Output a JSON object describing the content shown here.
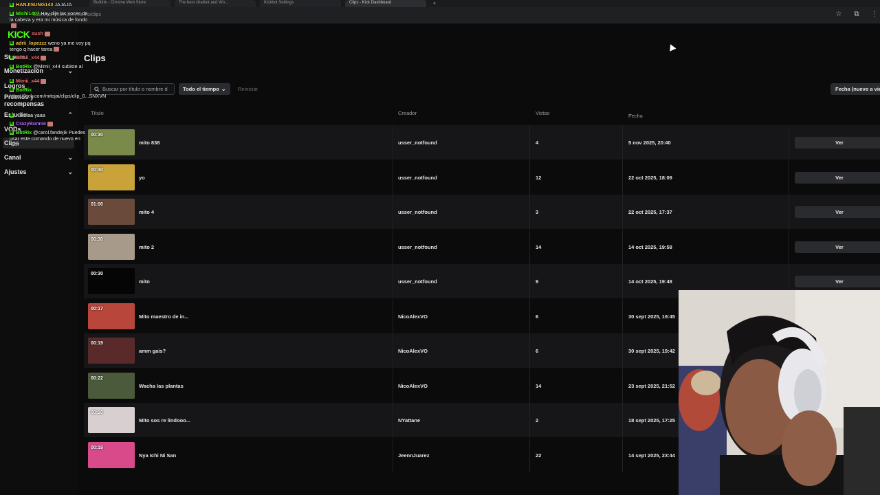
{
  "browser": {
    "tabs": [
      "Builtink - Chrome Web Store",
      "The best chatbot and Wo...",
      "Kickbot Settings",
      "Clips - Kick Dashboard"
    ],
    "url": "dashboard.kick.com/studio/clips"
  },
  "chat": {
    "logo": "KICK",
    "messages": [
      {
        "user": "HANJISUNG143",
        "user_color": "#f6c343",
        "text": "JAJAJA"
      },
      {
        "user": "Michi1407",
        "user_color": "#53fc18",
        "text": "Hay dije las voces de la cabeza y era mi música de fondo"
      },
      {
        "user": "sush",
        "user_color": "#f26d6d",
        "text": ""
      },
      {
        "user": "adrii_lopezzz",
        "user_color": "#f6c343",
        "text": "weno ya me voy pq tengo q hacer tarea"
      },
      {
        "user": "Mimii_x44",
        "user_color": "#f26d6d",
        "text": ""
      },
      {
        "user": "BotRix",
        "user_color": "#53fc18",
        "text": "@Mimii_x44 subiste al"
      },
      {
        "user": "Mimii_x44",
        "user_color": "#f26d6d",
        "text": ""
      },
      {
        "user": "BotRix",
        "user_color": "#53fc18",
        "text": "https://kick.com/mitojai/clips/clip_0...SNXVN"
      },
      {
        "user": "Kikelaa",
        "user_color": "#cfcfcf",
        "text": "yaaa"
      },
      {
        "user": "CrazyBunnie",
        "user_color": "#b86bff",
        "text": ""
      },
      {
        "user": "BotRix",
        "user_color": "#53fc18",
        "text": "@carol.fandejik Puedes usar este comando de nuevo en 49s."
      }
    ]
  },
  "sidebar": {
    "items": [
      {
        "label": "Stream",
        "has_chevron": false
      },
      {
        "label": "Monetización",
        "has_chevron": true
      },
      {
        "label": "Logros",
        "has_chevron": false
      },
      {
        "label": "Premios y recompensas",
        "has_chevron": false
      },
      {
        "label": "Estudio",
        "has_chevron": true
      },
      {
        "label": "VODs",
        "has_chevron": false
      },
      {
        "label": "Clips",
        "has_chevron": false
      },
      {
        "label": "Canal",
        "has_chevron": true
      },
      {
        "label": "Ajustes",
        "has_chevron": true
      }
    ]
  },
  "main": {
    "title": "Clips",
    "search_placeholder": "Buscar por título o nombre d",
    "time_filter": "Todo el tiempo",
    "reset_label": "Reiniciar",
    "sort_label": "Fecha (nuevo a viejo)",
    "columns": {
      "title": "Título",
      "creator": "Creador",
      "views": "Vistas",
      "date": "Fecha"
    },
    "rows": [
      {
        "duration": "00:30",
        "title": "mito 838",
        "creator": "usser_notfound",
        "views": "4",
        "date": "5 nov 2025, 20:40",
        "action": "Ver",
        "thumb_color": "#7a8a4a"
      },
      {
        "duration": "00:30",
        "title": "yo",
        "creator": "usser_notfound",
        "views": "12",
        "date": "22 oct 2025, 18:09",
        "action": "Ver",
        "thumb_color": "#c9a23a"
      },
      {
        "duration": "01:00",
        "title": "mito 4",
        "creator": "usser_notfound",
        "views": "3",
        "date": "22 oct 2025, 17:37",
        "action": "Ver",
        "thumb_color": "#6a4a3a"
      },
      {
        "duration": "00:30",
        "title": "mito 2",
        "creator": "usser_notfound",
        "views": "14",
        "date": "14 oct 2025, 19:58",
        "action": "Ver",
        "thumb_color": "#a89a8a"
      },
      {
        "duration": "00:30",
        "title": "mito",
        "creator": "usser_notfound",
        "views": "9",
        "date": "14 oct 2025, 19:48",
        "action": "Ver",
        "thumb_color": "#050505"
      },
      {
        "duration": "00:17",
        "title": "Mito maestro de in...",
        "creator": "NicoAlexVO",
        "views": "6",
        "date": "30 sept 2025, 19:45",
        "action": "Ver",
        "thumb_color": "#b8463a"
      },
      {
        "duration": "00:19",
        "title": "amm gais?",
        "creator": "NicoAlexVO",
        "views": "6",
        "date": "30 sept 2025, 19:42",
        "action": "Ver",
        "thumb_color": "#5a2a2a"
      },
      {
        "duration": "00:22",
        "title": "Wacha las plantas",
        "creator": "NicoAlexVO",
        "views": "14",
        "date": "23 sept 2025, 21:52",
        "action": "Ver",
        "thumb_color": "#4a5a3a"
      },
      {
        "duration": "00:20",
        "title": "Mito sos re lindooo...",
        "creator": "NYattane",
        "views": "2",
        "date": "18 sept 2025, 17:25",
        "action": "Ver",
        "thumb_color": "#d8d0d0"
      },
      {
        "duration": "00:19",
        "title": "Nya Ichi Ni San",
        "creator": "JeennJuarez",
        "views": "22",
        "date": "14 sept 2025, 23:44",
        "action": "Ver",
        "thumb_color": "#d84a8a"
      }
    ]
  },
  "colors": {
    "kick_green": "#53fc18",
    "row_alt": "#161618",
    "button_bg": "#2a2b2e"
  }
}
